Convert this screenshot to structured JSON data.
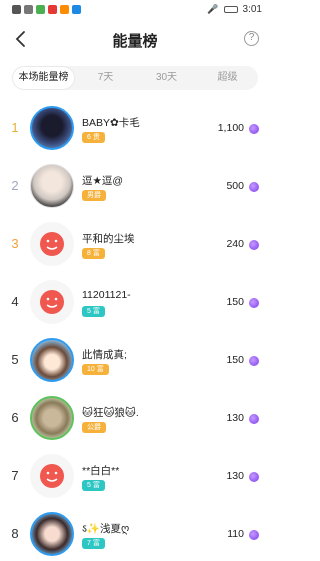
{
  "status": {
    "time": "3:01"
  },
  "header": {
    "title": "能量榜"
  },
  "tabs": [
    {
      "label": "本场能量榜",
      "active": true
    },
    {
      "label": "7天",
      "active": false
    },
    {
      "label": "30天",
      "active": false
    },
    {
      "label": "超级",
      "active": false
    }
  ],
  "colors": {
    "rank1": "#e2b13c",
    "rank2": "#a0a8c0",
    "rank3": "#f0a03c",
    "badge_orange": "#f5b13a",
    "badge_cyan": "#2ec6c2",
    "coin": "#7c3aed"
  },
  "ranking": [
    {
      "rank": "1",
      "name": "BABY✿卡毛",
      "badge": "6 贵",
      "value": "1,100"
    },
    {
      "rank": "2",
      "name": "逗★逗@",
      "badge": "男爵",
      "value": "500"
    },
    {
      "rank": "3",
      "name": "平和的尘埃",
      "badge": "8 富",
      "value": "240"
    },
    {
      "rank": "4",
      "name": "11201121-",
      "badge": "5 富",
      "value": "150"
    },
    {
      "rank": "5",
      "name": "此情成真;",
      "badge": "10 富",
      "value": "150"
    },
    {
      "rank": "6",
      "name": "🐱狂🐱狼🐱.",
      "badge": "公爵",
      "value": "130"
    },
    {
      "rank": "7",
      "name": "**白白**",
      "badge": "5 富",
      "value": "130"
    },
    {
      "rank": "8",
      "name": "ऽ✨浅夏ღ",
      "badge": "7 富",
      "value": "110"
    }
  ]
}
